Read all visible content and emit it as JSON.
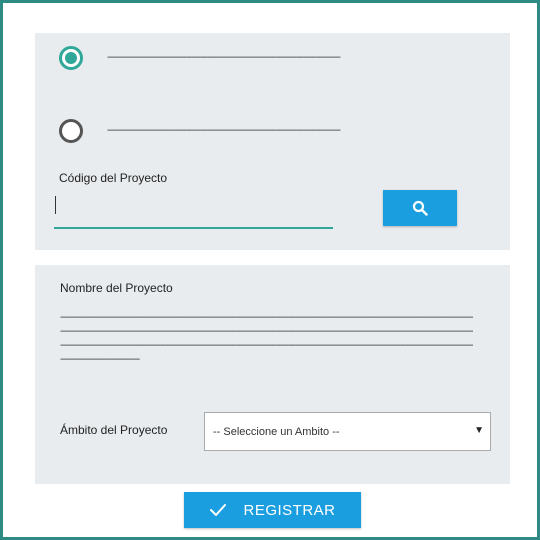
{
  "colors": {
    "accent": "#2fa89a",
    "button": "#1a9ee0",
    "panel": "#e9ecef",
    "frame": "#2e8b84"
  },
  "options": [
    {
      "label": "----------------------------------------------------------------------------------------------------",
      "checked": true
    },
    {
      "label": "----------------------------------------------------------------------------------------------------",
      "checked": false
    }
  ],
  "codigo": {
    "label": "Código del Proyecto",
    "value": "",
    "search_icon": "search-icon"
  },
  "nombre": {
    "label": "Nombre del Proyecto",
    "value": "-------------------------------------------------------------------------------------------------------------------------------------------------------------------------------------------------------------------------------------------------------------------------------------------------------------------------------------------------------------------------------------------------------------------------------------------------------------------------------------------------------------------------------------------------------------------------------------"
  },
  "ambito": {
    "label": "Ámbito del Proyecto",
    "selected": "-- Seleccione un Ambito --",
    "arrow_icon": "triangle-down-icon"
  },
  "registrar": {
    "label": "REGISTRAR",
    "icon": "check-icon"
  }
}
